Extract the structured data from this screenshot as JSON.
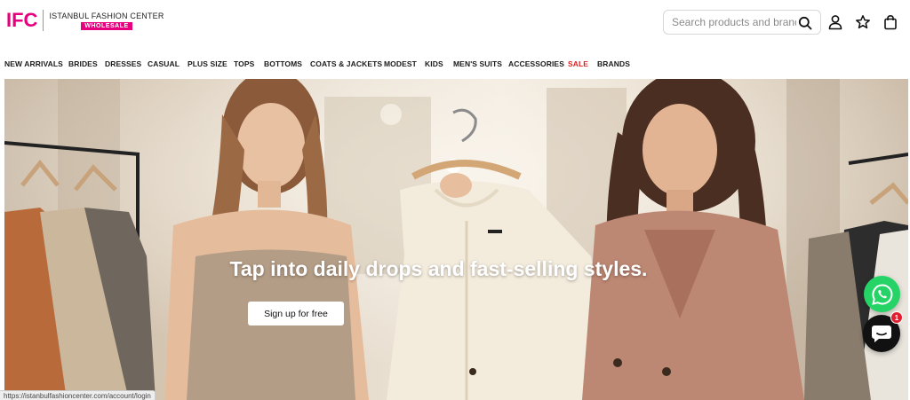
{
  "brand": {
    "mark": "IFC",
    "name": "ISTANBUL FASHION CENTER",
    "badge": "WHOLESALE",
    "accent_color": "#e6007e"
  },
  "search": {
    "placeholder": "Search products and brands",
    "icon": "search-icon"
  },
  "header_icons": [
    "account-icon",
    "wishlist-star-icon",
    "cart-bag-icon"
  ],
  "nav": {
    "items": [
      {
        "label": "NEW ARRIVALS"
      },
      {
        "label": "BRIDES"
      },
      {
        "label": "DRESSES"
      },
      {
        "label": "CASUAL"
      },
      {
        "label": "PLUS SIZE"
      },
      {
        "label": "TOPS"
      },
      {
        "label": "BOTTOMS"
      },
      {
        "label": "COATS & JACKETS"
      },
      {
        "label": "MODEST"
      },
      {
        "label": "KIDS"
      },
      {
        "label": "MEN'S SUITS"
      },
      {
        "label": "ACCESSORIES"
      },
      {
        "label": "SALE",
        "color": "#e02020"
      },
      {
        "label": "BRANDS"
      }
    ]
  },
  "hero": {
    "headline": "Tap into daily drops and fast-selling styles.",
    "cta_label": "Sign up for free"
  },
  "floating": {
    "whatsapp_icon": "whatsapp-icon",
    "whatsapp_color": "#25d366",
    "chat_icon": "chat-icon",
    "chat_badge": "1"
  },
  "status_bar": {
    "url": "https://istanbulfashioncenter.com/account/login"
  }
}
